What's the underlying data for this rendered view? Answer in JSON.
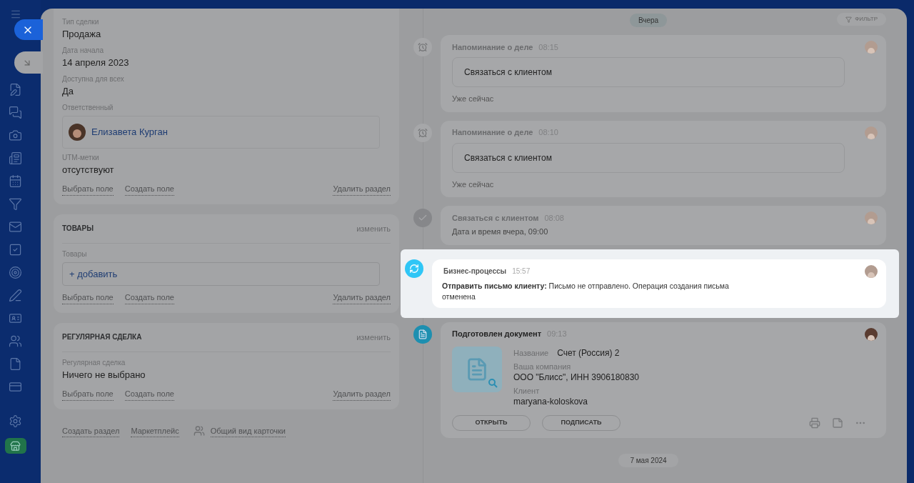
{
  "left_sections": [
    {
      "fields": [
        {
          "kind": "text",
          "label": "Тип сделки",
          "value": "Продажа"
        },
        {
          "kind": "text",
          "label": "Дата начала",
          "value": "14 апреля 2023"
        },
        {
          "kind": "text",
          "label": "Доступна для всех",
          "value": "Да"
        },
        {
          "kind": "person",
          "label": "Ответственный",
          "value": "Елизавета Курган"
        },
        {
          "kind": "text",
          "label": "UTM-метки",
          "value": "отсутствуют"
        }
      ],
      "actions": [
        "Выбрать поле",
        "Создать поле"
      ],
      "delete": "Удалить раздел"
    },
    {
      "title": "ТОВАРЫ",
      "edit": "изменить",
      "fields": [
        {
          "kind": "add",
          "label": "Товары",
          "value": "+ добавить"
        }
      ],
      "actions": [
        "Выбрать поле",
        "Создать поле"
      ],
      "delete": "Удалить раздел"
    },
    {
      "title": "РЕГУЛЯРНАЯ СДЕЛКА",
      "edit": "изменить",
      "fields": [
        {
          "kind": "text",
          "label": "Регулярная сделка",
          "value": "Ничего не выбрано"
        }
      ],
      "actions": [
        "Выбрать поле",
        "Создать поле"
      ],
      "delete": "Удалить раздел"
    }
  ],
  "footer_links": [
    {
      "label": "Создать раздел",
      "kind": "link"
    },
    {
      "label": "Маркетплейс",
      "kind": "link"
    },
    {
      "label": "Общий вид карточки",
      "kind": "icon-link"
    }
  ],
  "timeline": {
    "date": "Вчера",
    "filter": "ФИЛЬТР",
    "items": [
      {
        "kind": "reminder",
        "highlighted": false,
        "title": "Напоминание о деле",
        "time": "08:15",
        "body": "Связаться с клиентом",
        "note": "Уже сейчас"
      },
      {
        "kind": "reminder",
        "highlighted": false,
        "title": "Напоминание о деле",
        "time": "08:10",
        "body": "Связаться с клиентом",
        "note": "Уже сейчас"
      },
      {
        "kind": "done",
        "highlighted": false,
        "title": "Связаться с клиентом",
        "time": "08:08",
        "body": "Дата и время вчера, 09:00"
      },
      {
        "kind": "process",
        "highlighted": true,
        "title": "Бизнес-процессы",
        "time": "15:57",
        "body": "**Отправить письмо клиенту:** Письмо не отправлено. Операция создания письма отменена"
      },
      {
        "kind": "document",
        "highlighted": false,
        "title": "Подготовлен документ",
        "time": "09:13",
        "fields": [
          {
            "label": "Название",
            "value": "Счет (Россия) 2"
          },
          {
            "label": "Ваша компания",
            "value": "ООО \"Блисс\", ИНН 3906180830"
          },
          {
            "label": "Клиент",
            "value": "maryana-koloskova"
          }
        ],
        "buttons": [
          "ОТКРЫТЬ",
          "ПОДПИСАТЬ"
        ]
      }
    ],
    "end_date": "7 мая 2024"
  }
}
